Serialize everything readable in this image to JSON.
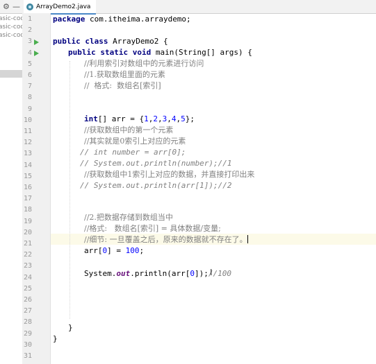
{
  "toolbar": {
    "gear": "⚙",
    "minimize": "—"
  },
  "tab": {
    "title": "ArrayDemo2.java"
  },
  "project": {
    "items": [
      "asic-code",
      "asic-code",
      "asic-code"
    ]
  },
  "editor": {
    "lines": [
      {
        "n": "1"
      },
      {
        "n": "2"
      },
      {
        "n": "3"
      },
      {
        "n": "4"
      },
      {
        "n": "5"
      },
      {
        "n": "6"
      },
      {
        "n": "7"
      },
      {
        "n": "8"
      },
      {
        "n": "9"
      },
      {
        "n": "10"
      },
      {
        "n": "11"
      },
      {
        "n": "12"
      },
      {
        "n": "13"
      },
      {
        "n": "14"
      },
      {
        "n": "15"
      },
      {
        "n": "16"
      },
      {
        "n": "17"
      },
      {
        "n": "18"
      },
      {
        "n": "19"
      },
      {
        "n": "20"
      },
      {
        "n": "21"
      },
      {
        "n": "22"
      },
      {
        "n": "23"
      },
      {
        "n": "24"
      },
      {
        "n": "25"
      },
      {
        "n": "26"
      },
      {
        "n": "27"
      },
      {
        "n": "28"
      },
      {
        "n": "29"
      },
      {
        "n": "30"
      },
      {
        "n": "31"
      }
    ],
    "code": {
      "l1_kw": "package",
      "l1_rest": " com.itheima.arraydemo;",
      "l3_kw": "public class",
      "l3_rest": " ArrayDemo2 {",
      "l4_kw": "public static void",
      "l4_rest": " main(String[] args) {",
      "l5": "//利用索引对数组中的元素进行访问",
      "l6": "//1.获取数组里面的元素",
      "l7": "//  格式:  数组名[索引]",
      "l10_kw": "int",
      "l10_a": "[] arr = {",
      "l10_n1": "1",
      "l10_n2": "2",
      "l10_n3": "3",
      "l10_n4": "4",
      "l10_n5": "5",
      "l10_b": "};",
      "l11": "//获取数组中的第一个元素",
      "l12": "//其实就是0索引上对应的元素",
      "l13": "// int number = arr[0];",
      "l14": "// System.out.println(number);//1",
      "l15": "//获取数组中1索引上对应的数据，并直接打印出来",
      "l16": "// System.out.println(arr[1]);//2",
      "l19": "//2.把数据存储到数组当中",
      "l20": "//格式:   数组名[索引] = 具体数据/变量;",
      "l21": "//细节: 一旦覆盖之后，原来的数据就不存在了。",
      "l22_a": "arr[",
      "l22_n1": "0",
      "l22_b": "] = ",
      "l22_n2": "100",
      "l22_c": ";",
      "l24_a": "System.",
      "l24_out": "out",
      "l24_b": ".println(arr[",
      "l24_n": "0",
      "l24_c": "]);",
      "l24_cm": "//100",
      "l29": "}",
      "l30": "}"
    }
  }
}
